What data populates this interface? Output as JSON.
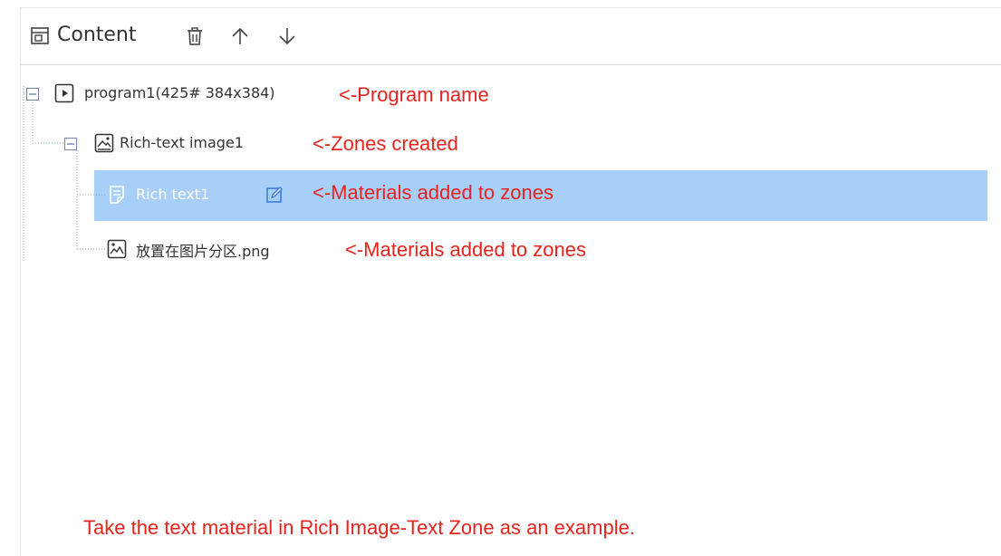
{
  "header": {
    "title": "Content",
    "icons": [
      "content-panel-icon",
      "delete-icon",
      "move-up-icon",
      "move-down-icon"
    ]
  },
  "tree": {
    "program": {
      "label": "program1(425# 384x384)",
      "note": "<-Program name"
    },
    "zone": {
      "label": "Rich-text image1",
      "note": "<-Zones created"
    },
    "materials": [
      {
        "label": "Rich text1",
        "note": "<-Materials added to zones",
        "selected": true
      },
      {
        "label": "放置在图片分区.png",
        "note": "<-Materials added to zones",
        "selected": false
      }
    ]
  },
  "footer_note": "Take the text material in Rich Image-Text Zone as an example.",
  "colors": {
    "accent_selected": "#a7cff8",
    "note_red": "#e8231d",
    "tree_line": "#8aa0c8"
  }
}
